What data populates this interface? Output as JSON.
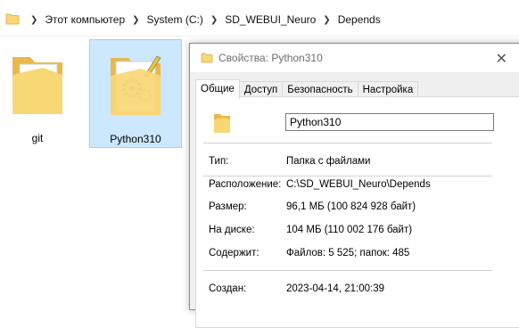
{
  "address_bar": {
    "crumbs": [
      "Этот компьютер",
      "System (C:)",
      "SD_WEBUI_Neuro",
      "Depends"
    ]
  },
  "items": [
    {
      "label": "git"
    },
    {
      "label": "Python310"
    }
  ],
  "dialog": {
    "title": "Свойства: Python310",
    "close": "✕",
    "tabs": [
      "Общие",
      "Доступ",
      "Безопасность",
      "Настройка"
    ],
    "active_tab": "Общие",
    "name_value": "Python310",
    "props": [
      {
        "key": "Тип:",
        "value": "Папка с файлами"
      },
      {
        "key": "Расположение:",
        "value": "C:\\SD_WEBUI_Neuro\\Depends"
      },
      {
        "key": "Размер:",
        "value": "96,1 МБ (100 824 928 байт)"
      },
      {
        "key": "На диске:",
        "value": "104 МБ (110 002 176 байт)"
      },
      {
        "key": "Содержит:",
        "value": "Файлов: 5 525; папок: 485"
      },
      {
        "key": "Создан:",
        "value": "2023-04-14, 21:00:39"
      }
    ]
  },
  "colors": {
    "folder_yellow": "#f8d775",
    "selection_bg": "#cce8ff",
    "selection_border": "#99d1ff"
  }
}
